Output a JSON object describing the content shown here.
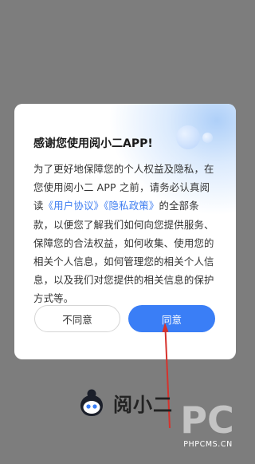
{
  "dialog": {
    "title": "感谢您使用阅小二APP!",
    "body": {
      "part1": "为了更好地保障您的个人权益及隐私，在您使用阅小二 APP 之前，请务必认真阅读",
      "user_agreement": "《用户协议》",
      "privacy_policy": "《隐私政策》",
      "part2": "的全部条款，以便您了解我们如何向您提供服务、保障您的合法权益，如何收集、使用您的相关个人信息，如何管理您的相关个人信息，以及我们对您提供的相关信息的保护方式等。"
    },
    "disagree_label": "不同意",
    "agree_label": "同意"
  },
  "brand": {
    "name": "阅小二"
  },
  "watermark": {
    "text": "PHPCMS.CN",
    "logo_text": "PC"
  },
  "colors": {
    "accent": "#3a7ef6",
    "link": "#3f7ef1",
    "overlay": "#7d7d7d",
    "annotation_arrow": "#d6322c"
  }
}
